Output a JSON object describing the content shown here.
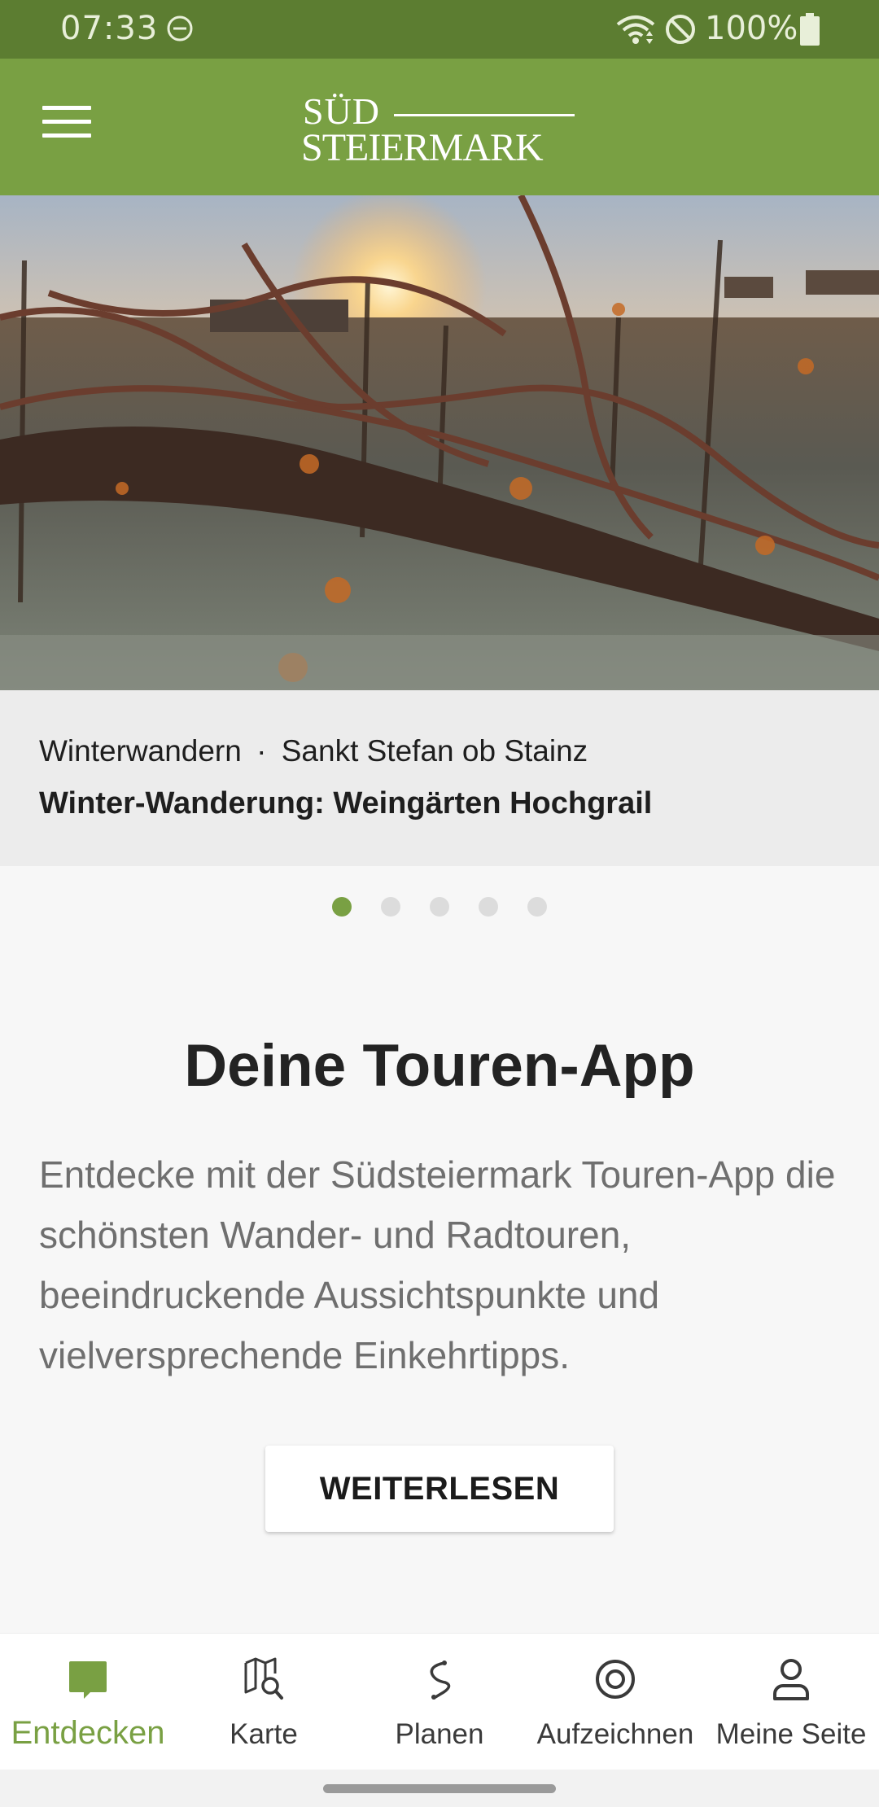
{
  "status_bar": {
    "time": "07:33",
    "battery_text": "100%",
    "icons": [
      "do-not-disturb-icon",
      "wifi-icon",
      "blocked-icon",
      "battery-icon"
    ]
  },
  "app_bar": {
    "menu_icon": "hamburger-menu-icon",
    "logo_line1": "SÜD",
    "logo_line2": "STEIERMARK"
  },
  "hero": {
    "image": "frosty-vineyard-at-sunrise",
    "category": "Winterwandern",
    "separator": "·",
    "location": "Sankt Stefan ob Stainz",
    "title": "Winter-Wanderung: Weingärten Hochgrail"
  },
  "carousel": {
    "count": 5,
    "active_index": 0
  },
  "intro": {
    "headline": "Deine Touren-App",
    "text": "Entdecke mit der Südsteiermark Touren-App die schönsten Wander- und Radtouren, beeindruckende Aussichtspunkte und vielversprechende Einkehrtipps.",
    "button_label": "WEITERLESEN"
  },
  "bottom_nav": {
    "items": [
      {
        "label": "Entdecken",
        "icon": "discover-icon",
        "active": true
      },
      {
        "label": "Karte",
        "icon": "map-search-icon",
        "active": false
      },
      {
        "label": "Planen",
        "icon": "route-plan-icon",
        "active": false
      },
      {
        "label": "Aufzeichnen",
        "icon": "record-icon",
        "active": false
      },
      {
        "label": "Meine Seite",
        "icon": "profile-icon",
        "active": false
      }
    ]
  },
  "colors": {
    "status_bar": "#5c7d31",
    "brand_green": "#79a043",
    "caption_bg": "#ececec",
    "page_bg": "#f7f7f7"
  }
}
